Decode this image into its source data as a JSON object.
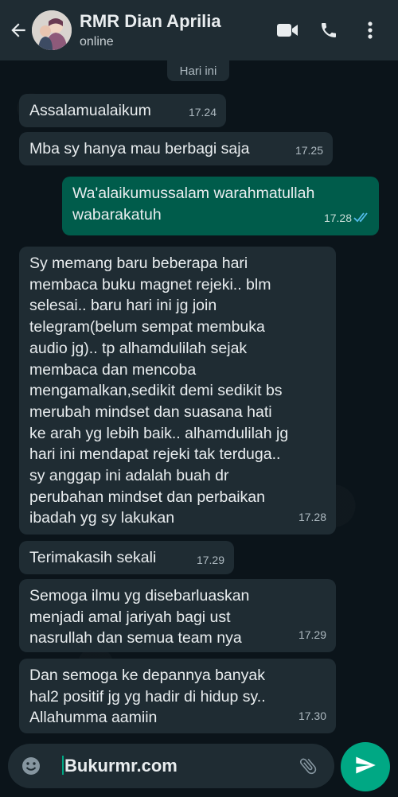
{
  "header": {
    "contact_name": "RMR Dian Aprilia",
    "status": "online",
    "icons": [
      "back-arrow-icon",
      "video-call-icon",
      "voice-call-icon",
      "more-options-icon"
    ]
  },
  "chat": {
    "date_chip": "Hari ini",
    "messages": [
      {
        "direction": "in",
        "text": "Assalamualaikum",
        "time": "17.24"
      },
      {
        "direction": "in",
        "text": "Mba sy hanya mau berbagi saja",
        "time": "17.25"
      },
      {
        "direction": "out",
        "text": "Wa'alaikumussalam warahmatullah\nwabarakatuh",
        "time": "17.28",
        "read": true
      },
      {
        "direction": "in",
        "text": "Sy memang baru beberapa hari\nmembaca buku magnet rejeki.. blm\nselesai.. baru hari ini jg join\ntelegram(belum sempat membuka\naudio jg).. tp alhamdulilah sejak\nmembaca dan mencoba\nmengamalkan,sedikit demi sedikit bs\nmerubah mindset dan suasana hati\nke arah yg lebih baik.. alhamdulilah jg\nhari ini mendapat rejeki tak terduga..\nsy anggap ini adalah buah dr\nperubahan mindset dan perbaikan\nibadah yg sy lakukan",
        "time": "17.28"
      },
      {
        "direction": "in",
        "text": "Terimakasih sekali",
        "time": "17.29"
      },
      {
        "direction": "in",
        "text": "Semoga ilmu yg disebarluaskan\nmenjadi amal jariyah bagi ust\nnasrullah dan semua team nya",
        "time": "17.29"
      },
      {
        "direction": "in",
        "text": "Dan semoga ke depannya banyak\nhal2 positif jg yg hadir di hidup sy..\nAllahumma aamiin",
        "time": "17.30"
      }
    ]
  },
  "composer": {
    "value": "Bukurmr.com",
    "icons": [
      "emoji-icon",
      "attach-icon",
      "send-icon"
    ],
    "accent": "#00a884"
  },
  "colors": {
    "background": "#0b141a",
    "header": "#1f2c33",
    "incoming_bubble": "#1f2c33",
    "outgoing_bubble": "#005c4b",
    "read_ticks": "#53bdeb"
  }
}
